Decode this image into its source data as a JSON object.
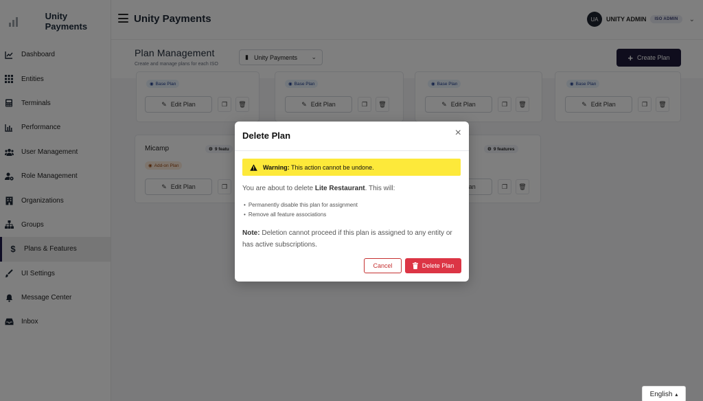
{
  "brand": {
    "name": "Unity Payments"
  },
  "header": {
    "title": "Unity Payments",
    "user_initials": "UA",
    "user_name": "UNITY ADMIN",
    "role": "ISO ADMIN"
  },
  "sidebar": {
    "items": [
      {
        "label": "Dashboard",
        "icon": "chart-line-icon"
      },
      {
        "label": "Entities",
        "icon": "grid-icon"
      },
      {
        "label": "Terminals",
        "icon": "terminal-icon"
      },
      {
        "label": "Performance",
        "icon": "bar-chart-icon"
      },
      {
        "label": "User Management",
        "icon": "users-icon"
      },
      {
        "label": "Role Management",
        "icon": "user-gear-icon"
      },
      {
        "label": "Organizations",
        "icon": "building-icon"
      },
      {
        "label": "Groups",
        "icon": "sitemap-icon"
      },
      {
        "label": "Plans & Features",
        "icon": "dollar-icon",
        "active": true
      },
      {
        "label": "UI Settings",
        "icon": "brush-icon"
      },
      {
        "label": "Message Center",
        "icon": "bell-icon"
      },
      {
        "label": "Inbox",
        "icon": "inbox-icon"
      }
    ]
  },
  "page": {
    "title": "Plan Management",
    "subtitle": "Create and manage plans for each ISO",
    "iso_select_value": "Unity Payments",
    "create_button": "Create Plan"
  },
  "cards": {
    "base_label": "Base Plan",
    "addon_label": "Add-on Plan",
    "edit_label": "Edit Plan",
    "micamp_name": "Micamp",
    "micamp_features": "9 featu",
    "right_features": "9 features"
  },
  "modal": {
    "title": "Delete Plan",
    "close": "×",
    "warning_strong": "Warning:",
    "warning_text": "This action cannot be undone.",
    "intro_prefix": "You are about to delete ",
    "plan_name": "Lite Restaurant",
    "intro_suffix": ". This will:",
    "bullets": [
      "Permanently disable this plan for assignment",
      "Remove all feature associations"
    ],
    "note_strong": "Note:",
    "note_text": "Deletion cannot proceed if this plan is assigned to any entity or has active subscriptions.",
    "cancel": "Cancel",
    "delete": "Delete Plan"
  },
  "language": {
    "value": "English"
  },
  "colors": {
    "accent": "#1e1b3a",
    "danger": "#dc3545",
    "warning": "#fde93a"
  }
}
